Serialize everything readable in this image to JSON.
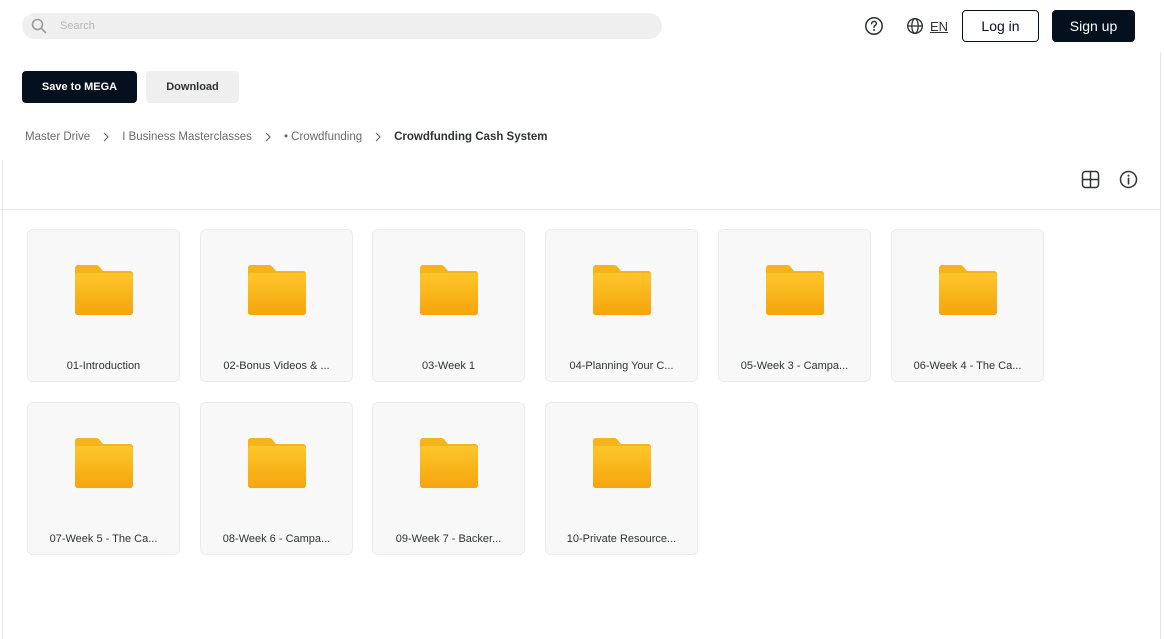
{
  "header": {
    "search": {
      "placeholder": "Search",
      "value": ""
    },
    "help_icon": "help-circle-icon",
    "language": "EN",
    "login_label": "Log in",
    "signup_label": "Sign up"
  },
  "toolbar": {
    "save_label": "Save to MEGA",
    "download_label": "Download"
  },
  "breadcrumb": [
    "Master Drive",
    "I Business Masterclasses",
    "• Crowdfunding",
    "Crowdfunding Cash System"
  ],
  "folders": [
    "01-Introduction",
    "02-Bonus Videos & ...",
    "03-Week 1",
    "04-Planning Your C...",
    "05-Week 3 - Campa...",
    "06-Week 4 - The Ca...",
    "07-Week 5 - The Ca...",
    "08-Week 6 - Campa...",
    "09-Week 7 - Backer...",
    "10-Private Resource..."
  ],
  "colors": {
    "primary_dark": "#04101e",
    "folder_top": "#fcc62a",
    "folder_bottom": "#f7a40d"
  }
}
